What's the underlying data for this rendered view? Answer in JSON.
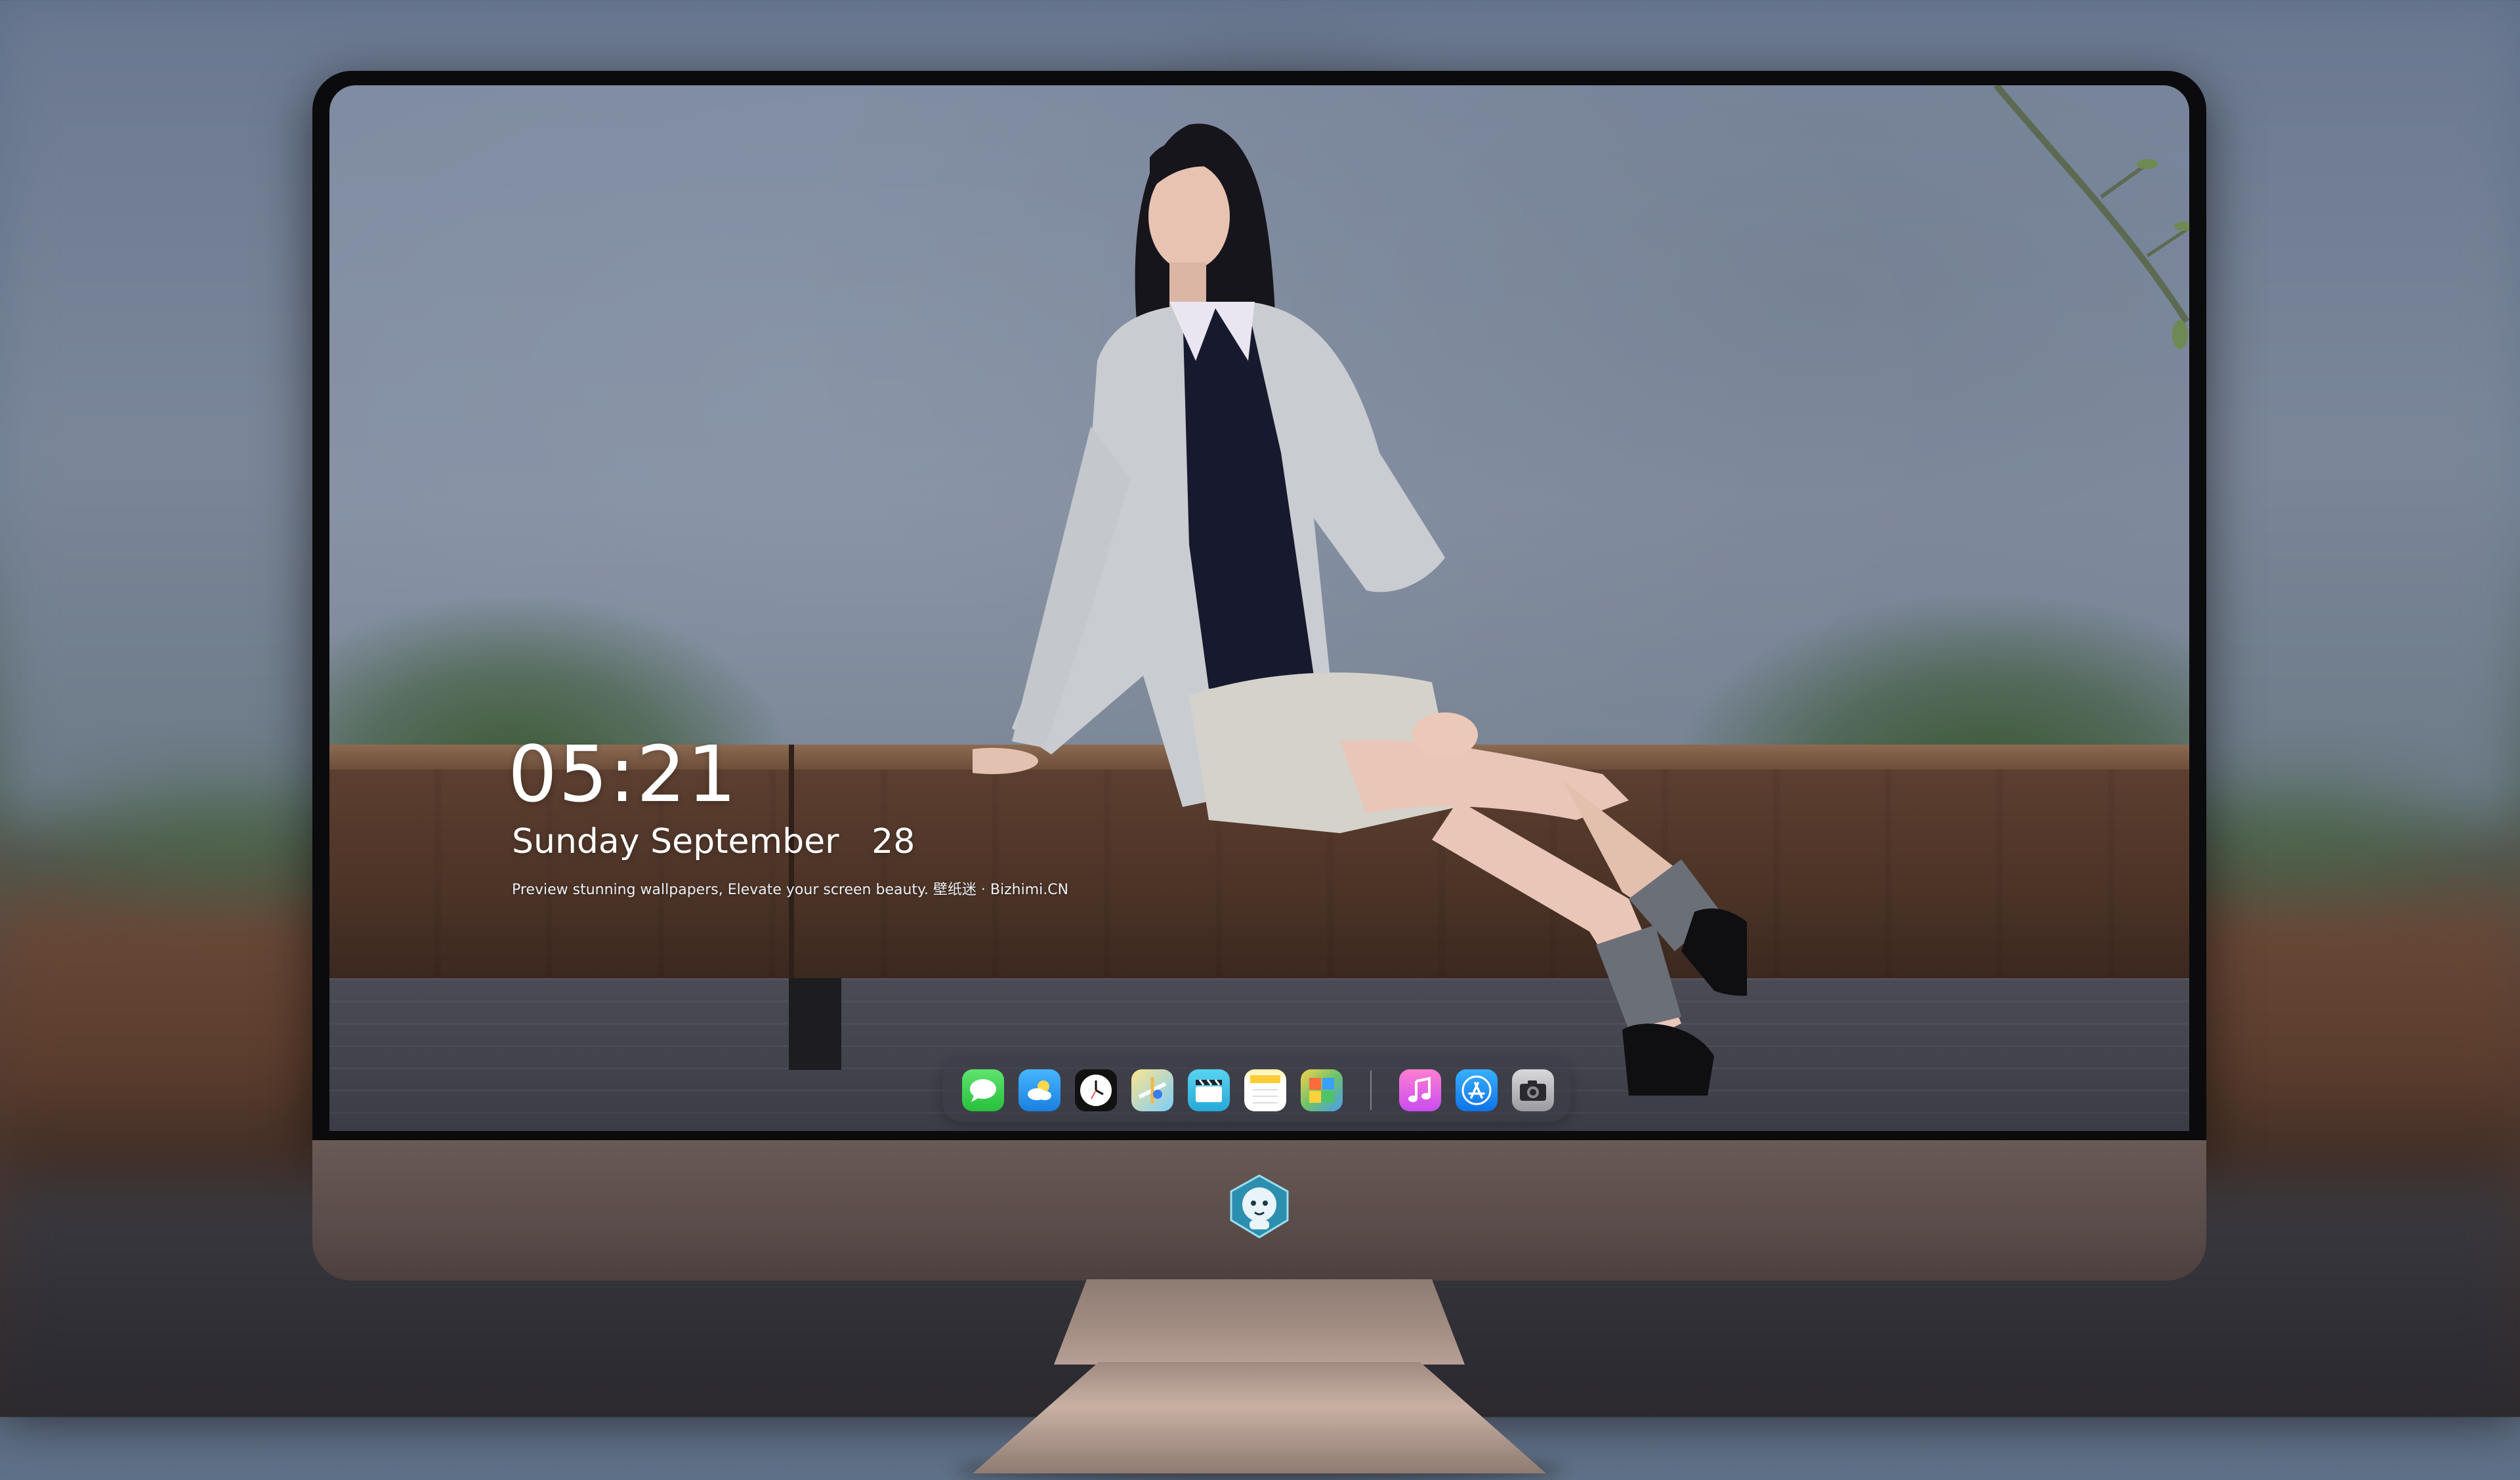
{
  "lock_screen": {
    "time": "05:21",
    "date": "Sunday September   28",
    "caption": "Preview stunning wallpapers, Elevate your screen beauty. 壁纸迷 · Bizhimi.CN"
  },
  "dock": {
    "items": [
      {
        "name": "messages",
        "icon": "message-bubble-icon"
      },
      {
        "name": "weather",
        "icon": "cloud-sun-icon"
      },
      {
        "name": "clock",
        "icon": "clock-icon"
      },
      {
        "name": "maps",
        "icon": "map-icon"
      },
      {
        "name": "videos",
        "icon": "clapperboard-icon"
      },
      {
        "name": "notes",
        "icon": "notes-icon"
      },
      {
        "name": "photos",
        "icon": "photos-icon"
      },
      {
        "name": "music",
        "icon": "music-note-icon"
      },
      {
        "name": "app-store",
        "icon": "app-store-icon"
      },
      {
        "name": "camera",
        "icon": "camera-icon"
      }
    ]
  },
  "colors": {
    "accent_messages": "#27c03b",
    "accent_weather": "#1a7fe0",
    "accent_music": "#c94cf0",
    "accent_store": "#0f73e8",
    "monitor_chin": "#5a4c49",
    "bezel": "#0b0b0d"
  },
  "logo": {
    "icon": "shield-logo-icon"
  }
}
